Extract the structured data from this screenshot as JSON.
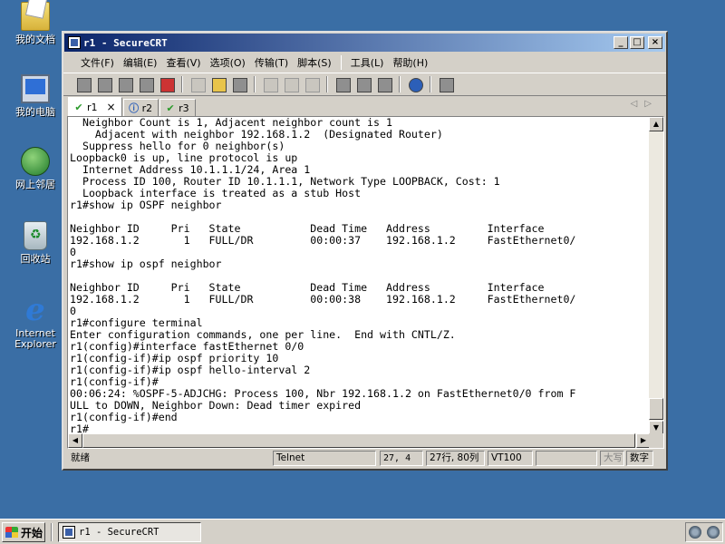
{
  "desktop": {
    "icons": [
      {
        "label": "我的文档",
        "icon": "my-documents-icon"
      },
      {
        "label": "我的电脑",
        "icon": "my-computer-icon"
      },
      {
        "label": "网上邻居",
        "icon": "network-places-icon"
      },
      {
        "label": "回收站",
        "icon": "recycle-bin-icon"
      },
      {
        "label": "Internet\nExplorer",
        "icon": "internet-explorer-icon"
      }
    ]
  },
  "window": {
    "title": "r1 - SecureCRT",
    "controls": {
      "minimize": "_",
      "maximize": "□",
      "close": "×"
    }
  },
  "menu": [
    "文件(F)",
    "编辑(E)",
    "查看(V)",
    "选项(O)",
    "传输(T)",
    "脚本(S)",
    "工具(L)",
    "帮助(H)"
  ],
  "tabs": [
    {
      "label": "r1",
      "status": "connected",
      "mark": "✔",
      "active": true,
      "close": "×"
    },
    {
      "label": "r2",
      "status": "info",
      "mark": "ⓘ",
      "active": false
    },
    {
      "label": "r3",
      "status": "connected",
      "mark": "✔",
      "active": false
    }
  ],
  "terminal": {
    "text": "  Neighbor Count is 1, Adjacent neighbor count is 1\n    Adjacent with neighbor 192.168.1.2  (Designated Router)\n  Suppress hello for 0 neighbor(s)\nLoopback0 is up, line protocol is up\n  Internet Address 10.1.1.1/24, Area 1\n  Process ID 100, Router ID 10.1.1.1, Network Type LOOPBACK, Cost: 1\n  Loopback interface is treated as a stub Host\nr1#show ip OSPF neighbor\n\nNeighbor ID     Pri   State           Dead Time   Address         Interface\n192.168.1.2       1   FULL/DR         00:00:37    192.168.1.2     FastEthernet0/\n0\nr1#show ip ospf neighbor\n\nNeighbor ID     Pri   State           Dead Time   Address         Interface\n192.168.1.2       1   FULL/DR         00:00:38    192.168.1.2     FastEthernet0/\n0\nr1#configure terminal\nEnter configuration commands, one per line.  End with CNTL/Z.\nr1(config)#interface fastEthernet 0/0\nr1(config-if)#ip ospf priority 10\nr1(config-if)#ip ospf hello-interval 2\nr1(config-if)#\n00:06:24: %OSPF-5-ADJCHG: Process 100, Nbr 192.168.1.2 on FastEthernet0/0 from F\nULL to DOWN, Neighbor Down: Dead timer expired\nr1(config-if)#end\nr1#"
  },
  "statusbar": {
    "status": "就绪",
    "protocol": "Telnet",
    "cursor": "27,  4",
    "size": "27行, 80列",
    "emulation": "VT100",
    "caps": "大写",
    "num": "数字"
  },
  "taskbar": {
    "start": "开始",
    "task": "r1 - SecureCRT"
  }
}
